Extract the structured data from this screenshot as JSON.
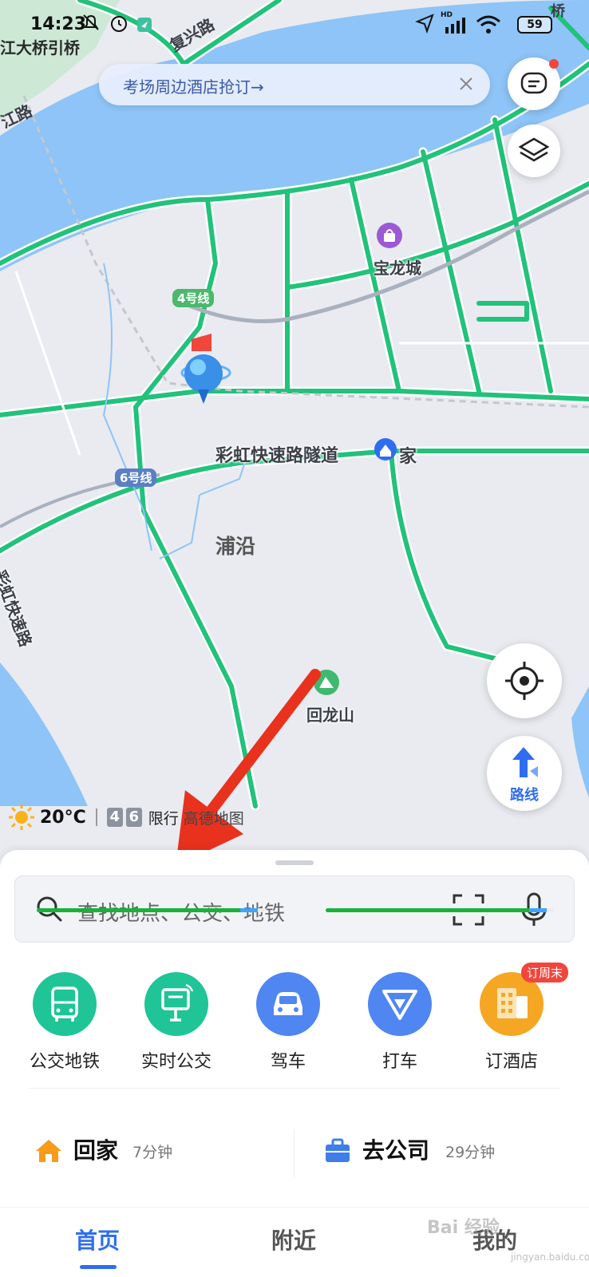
{
  "status_bar": {
    "time": "14:23",
    "battery": "59",
    "hd_label": "HD"
  },
  "banner": {
    "text": "考场周边酒店抢订→"
  },
  "map": {
    "labels": {
      "bridge_approach": "江大桥引桥",
      "fuxing_road": "复兴路",
      "jiang_road": "江路",
      "baolong_city": "宝龙城",
      "line4": "4号线",
      "line6": "6号线",
      "rainbow_tunnel": "彩虹快速路隧道",
      "home_marker": "家",
      "puyan": "浦沿",
      "rainbow_express": "彩虹快速路",
      "huilong_mountain": "回龙山",
      "corner_qiao": "桥"
    }
  },
  "route_button": {
    "label": "路线"
  },
  "weather": {
    "temperature": "20°C",
    "plate_digits": [
      "4",
      "6"
    ],
    "limit_label": "限行",
    "attribution": "高德地图"
  },
  "search": {
    "placeholder": "查找地点、公交、地铁"
  },
  "quick_actions": [
    {
      "label": "公交地铁",
      "color": "#1fc497",
      "icon": "bus-icon"
    },
    {
      "label": "实时公交",
      "color": "#1fc497",
      "icon": "bus-stop-icon"
    },
    {
      "label": "驾车",
      "color": "#4f86f2",
      "icon": "car-icon"
    },
    {
      "label": "打车",
      "color": "#4f86f2",
      "icon": "taxi-icon"
    },
    {
      "label": "订酒店",
      "color": "#f5a623",
      "icon": "hotel-icon",
      "badge": "订周末"
    }
  ],
  "shortcuts": {
    "home": {
      "title": "回家",
      "time": "7分钟",
      "progress": 0.97
    },
    "work": {
      "title": "去公司",
      "time": "29分钟",
      "progress": 0.97
    }
  },
  "tabs": [
    {
      "label": "首页",
      "active": true
    },
    {
      "label": "附近",
      "active": false
    },
    {
      "label": "我的",
      "active": false
    }
  ],
  "watermark": {
    "text": "Bai 经验",
    "url_text": "jingyan.baidu.com"
  },
  "colors": {
    "accent": "#2f6df0",
    "road_green": "#21c27a",
    "water": "#8ec4f7",
    "map_bg": "#e9ebf0",
    "arrow_red": "#e8321e"
  }
}
